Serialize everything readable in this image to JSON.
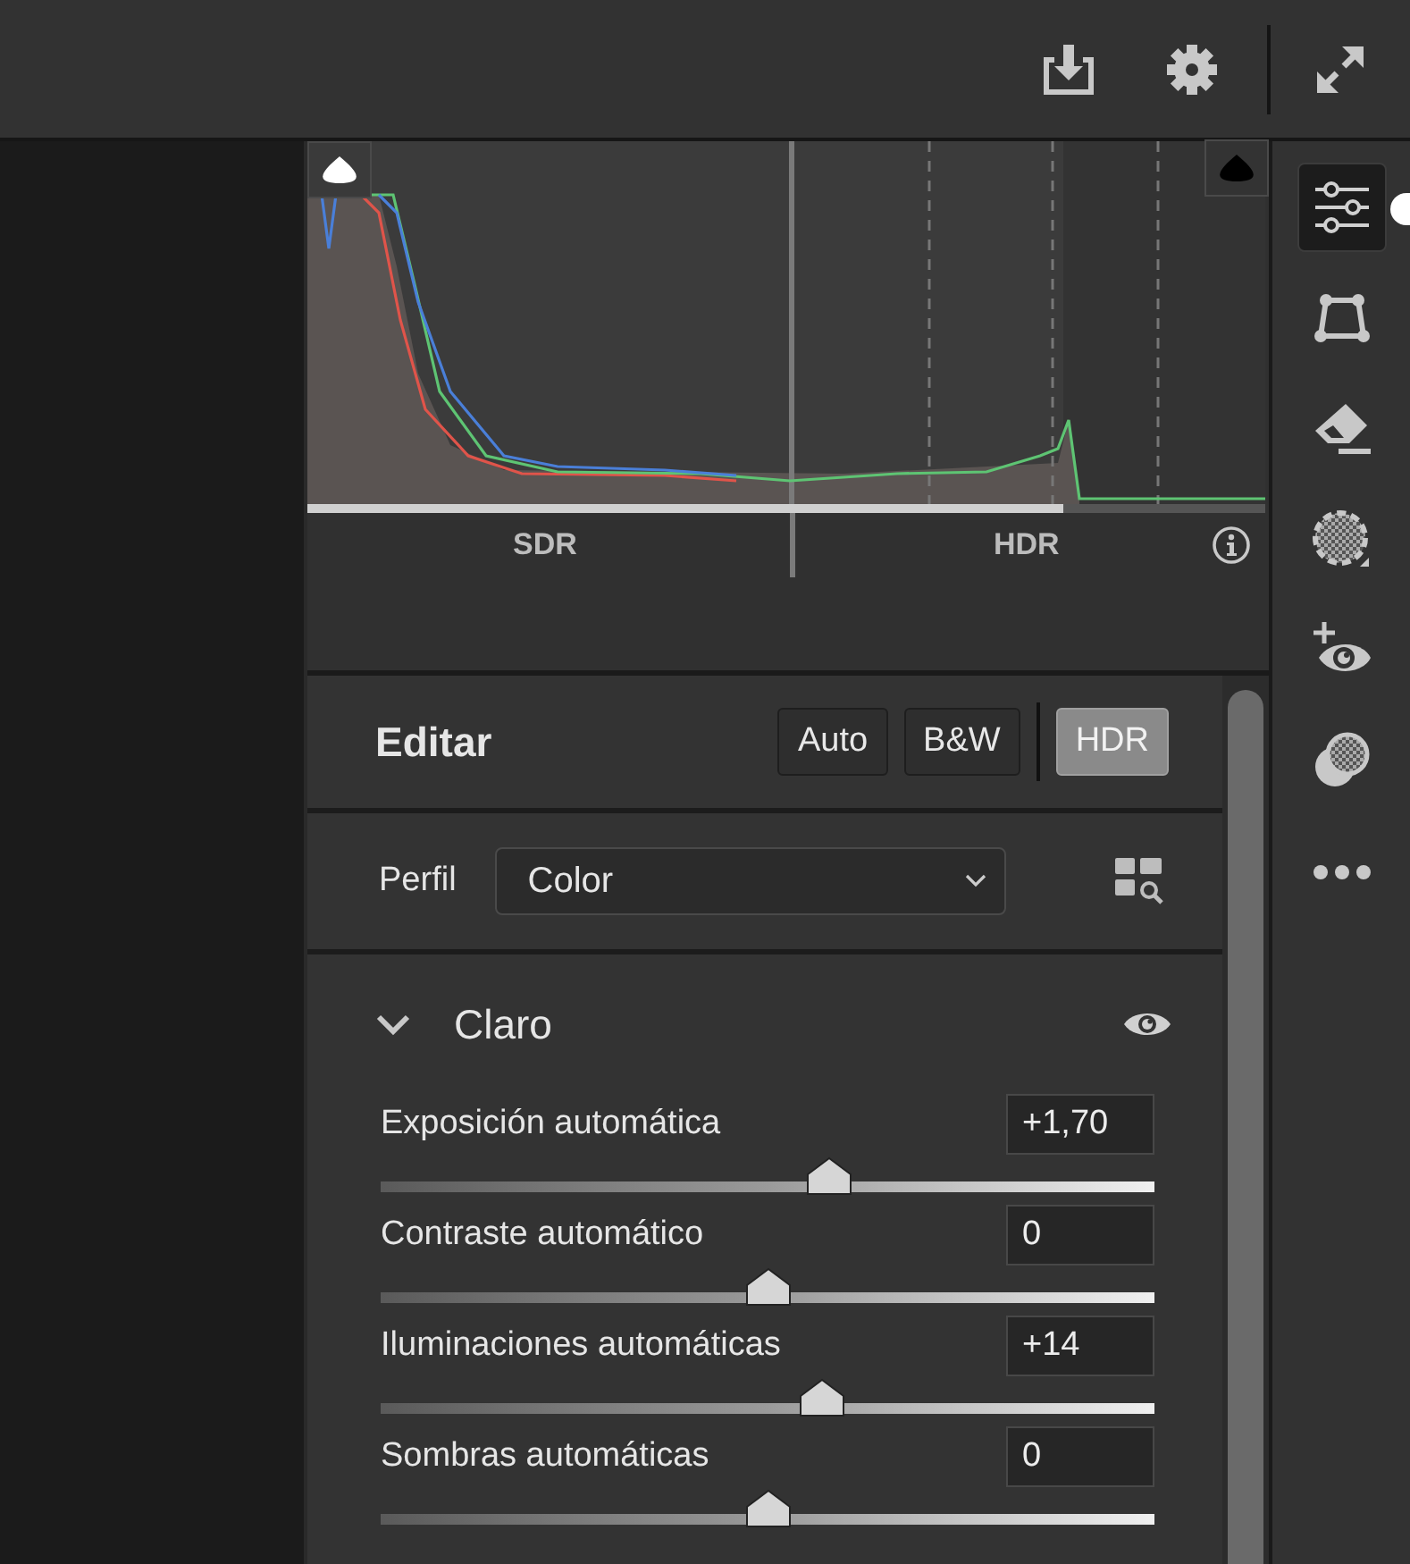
{
  "histogram": {
    "labels": [
      "SDR",
      "HDR"
    ]
  },
  "edit": {
    "title": "Editar",
    "modes": [
      {
        "label": "Auto",
        "selected": false
      },
      {
        "label": "B&W",
        "selected": false
      },
      {
        "label": "HDR",
        "selected": true
      }
    ]
  },
  "profile": {
    "label": "Perfil",
    "value": "Color"
  },
  "section": {
    "title": "Claro",
    "expanded": true,
    "sliders": [
      {
        "label": "Exposición automática",
        "value": "+1,70",
        "level": 0.58
      },
      {
        "label": "Contraste automático",
        "value": "0",
        "level": 0.5
      },
      {
        "label": "Iluminaciones automáticas",
        "value": "+14",
        "level": 0.57
      },
      {
        "label": "Sombras automáticas",
        "value": "0",
        "level": 0.5
      }
    ]
  },
  "tools": [
    {
      "selected": true
    },
    {
      "selected": false
    },
    {
      "selected": false
    },
    {
      "selected": false
    },
    {
      "selected": false
    },
    {
      "selected": false
    },
    {
      "selected": false
    }
  ]
}
